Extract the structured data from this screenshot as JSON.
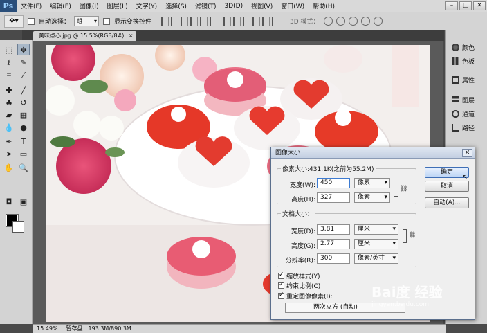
{
  "app": {
    "logo_text": "Ps"
  },
  "menu": [
    "文件(F)",
    "编辑(E)",
    "图像(I)",
    "图层(L)",
    "文字(Y)",
    "选择(S)",
    "滤镜(T)",
    "3D(D)",
    "视图(V)",
    "窗口(W)",
    "帮助(H)"
  ],
  "window_controls": {
    "minimize": "–",
    "maximize": "□",
    "close": "✕"
  },
  "options_bar": {
    "auto_select_label": "自动选择：",
    "auto_select_value": "组",
    "show_transform_label": "显示变换控件",
    "mode_3d_label": "3D 模式："
  },
  "document_tab": {
    "title": "美味点心.jpg @ 15.5%(RGB/8#)",
    "close": "×"
  },
  "status_bar": {
    "zoom": "15.49%",
    "doc_info": "暂存盘：193.3M/890.3M"
  },
  "right_panel": {
    "items": [
      {
        "label": "颜色",
        "icon": "palette-icon"
      },
      {
        "label": "色板",
        "icon": "swatches-icon"
      },
      {
        "label": "属性",
        "icon": "properties-icon"
      },
      {
        "label": "图层",
        "icon": "layers-icon"
      },
      {
        "label": "通道",
        "icon": "channels-icon"
      },
      {
        "label": "路径",
        "icon": "paths-icon"
      }
    ]
  },
  "colors": {
    "foreground": "#000000",
    "background": "#ffffff",
    "dialog_accent": "#3f6fb6"
  },
  "dialog": {
    "title": "图像大小",
    "close": "✕",
    "pixel_dimensions": {
      "title": "像素大小:431.1K(之前为55.2M)",
      "width_label": "宽度(W):",
      "width_value": "450",
      "width_unit": "像素",
      "height_label": "高度(H):",
      "height_value": "327",
      "height_unit": "像素"
    },
    "document_size": {
      "title": "文档大小：",
      "width_label": "宽度(D):",
      "width_value": "3.81",
      "width_unit": "厘米",
      "height_label": "高度(G):",
      "height_value": "2.77",
      "height_unit": "厘米",
      "resolution_label": "分辨率(R):",
      "resolution_value": "300",
      "resolution_unit": "像素/英寸"
    },
    "buttons": {
      "ok": "确定",
      "cancel": "取消",
      "auto": "自动(A)..."
    },
    "checkboxes": {
      "scale_styles": "缩放样式(Y)",
      "constrain_proportions": "约束比例(C)",
      "resample": "重定图像像素(I):"
    },
    "resample_method": "两次立方 (自动)"
  },
  "watermark": {
    "logo": "Bai度 经验",
    "sub": "jingyan.baidu.com"
  }
}
